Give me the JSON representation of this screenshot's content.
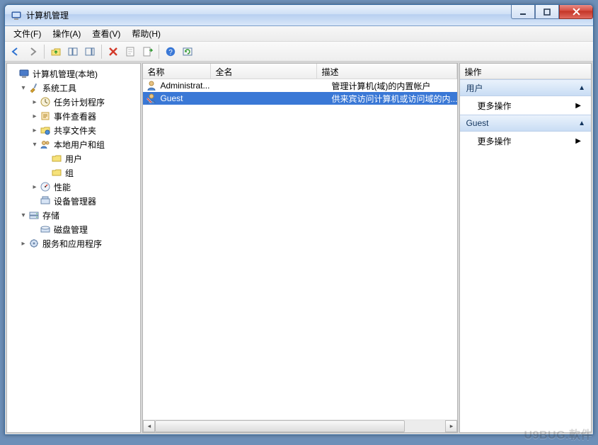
{
  "window": {
    "title": "计算机管理"
  },
  "menu": {
    "file": "文件(F)",
    "action": "操作(A)",
    "view": "查看(V)",
    "help": "帮助(H)"
  },
  "tree": {
    "root": "计算机管理(本地)",
    "system_tools": "系统工具",
    "task_scheduler": "任务计划程序",
    "event_viewer": "事件查看器",
    "shared_folders": "共享文件夹",
    "local_users_groups": "本地用户和组",
    "users": "用户",
    "groups": "组",
    "performance": "性能",
    "device_manager": "设备管理器",
    "storage": "存储",
    "disk_mgmt": "磁盘管理",
    "services_apps": "服务和应用程序"
  },
  "columns": {
    "name": "名称",
    "fullname": "全名",
    "description": "描述"
  },
  "users_list": [
    {
      "name": "Administrat...",
      "fullname": "",
      "description": "管理计算机(域)的内置帐户"
    },
    {
      "name": "Guest",
      "fullname": "",
      "description": "供来宾访问计算机或访问域的内..."
    }
  ],
  "selected_user_index": 1,
  "actions": {
    "header": "操作",
    "group1_title": "用户",
    "group1_item": "更多操作",
    "group2_title": "Guest",
    "group2_item": "更多操作"
  },
  "watermark": "U9BUG.軟件"
}
